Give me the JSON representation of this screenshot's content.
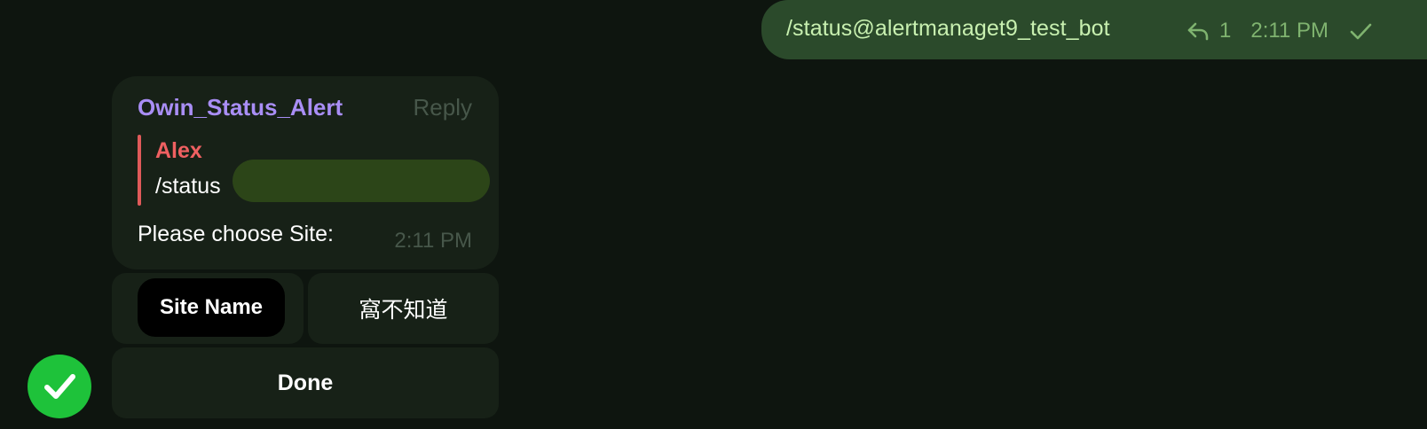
{
  "outgoing_message": {
    "text": "/status@alertmanaget9_test_bot",
    "reply_count": "1",
    "time": "2:11 PM",
    "status_icon": "check-icon",
    "reply_icon": "reply-arrow-icon"
  },
  "incoming_message": {
    "sender": "Owin_Status_Alert",
    "reply_label": "Reply",
    "quote": {
      "author": "Alex",
      "text": "/status"
    },
    "text": "Please choose Site:",
    "time": "2:11 PM"
  },
  "keyboard": {
    "buttons": [
      {
        "label": "Site Name"
      },
      {
        "label": "窩不知道"
      }
    ],
    "done_label": "Done"
  },
  "avatar": {
    "icon": "checkmark-icon"
  },
  "colors": {
    "background": "#0e150f",
    "outgoing_bubble": "#2b4a2b",
    "incoming_bubble": "#172117",
    "sender_name": "#a98ef5",
    "quote_author": "#ef6061",
    "avatar": "#1ec23a"
  }
}
